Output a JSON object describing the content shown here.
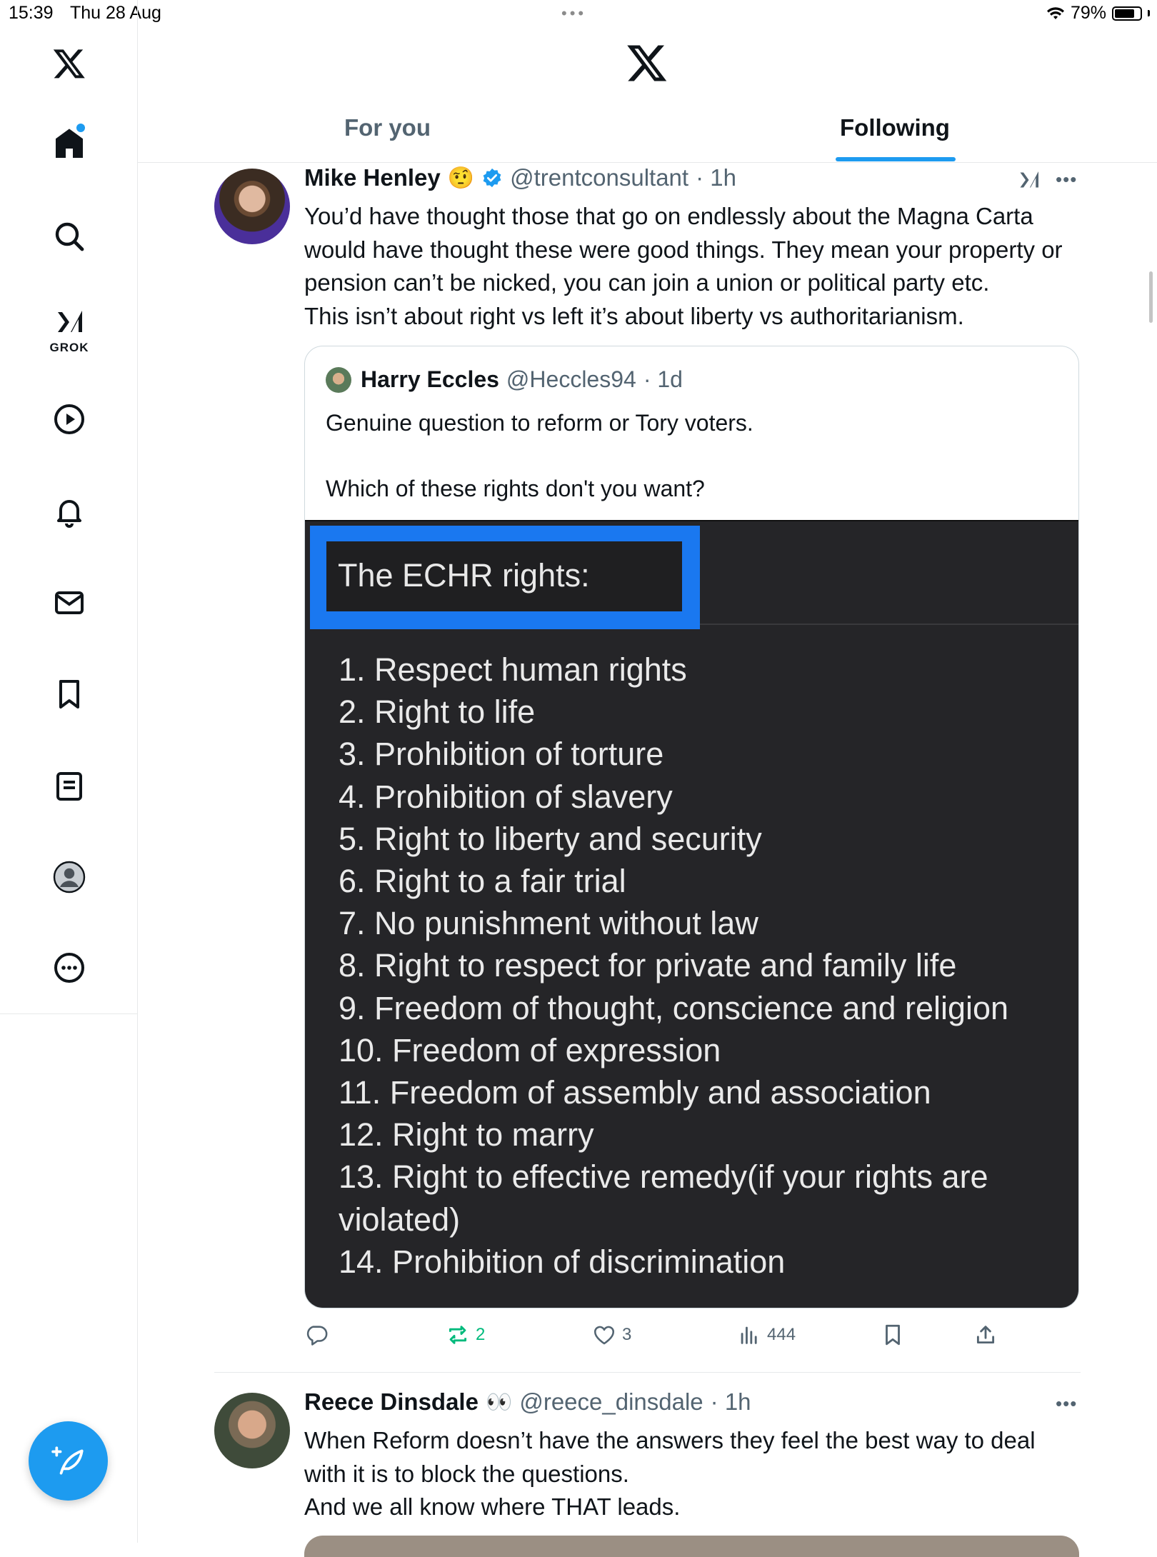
{
  "status_bar": {
    "time": "15:39",
    "date": "Thu 28 Aug",
    "battery": "79%",
    "battery_level": 0.79
  },
  "sidebar": {
    "items": [
      {
        "name": "home",
        "icon": "home-icon"
      },
      {
        "name": "search",
        "icon": "search-icon"
      },
      {
        "name": "grok",
        "icon": "grok-icon",
        "label": "GROK"
      },
      {
        "name": "video",
        "icon": "play-icon"
      },
      {
        "name": "notifications",
        "icon": "bell-icon"
      },
      {
        "name": "messages",
        "icon": "mail-icon"
      },
      {
        "name": "bookmarks",
        "icon": "bookmark-icon"
      },
      {
        "name": "lists",
        "icon": "list-icon"
      },
      {
        "name": "profile",
        "icon": "profile-icon"
      },
      {
        "name": "more",
        "icon": "more-icon"
      }
    ]
  },
  "header": {
    "tabs": [
      {
        "label": "For you",
        "active": false
      },
      {
        "label": "Following",
        "active": true
      }
    ]
  },
  "accent_color": "#1d9bf0",
  "tweets": [
    {
      "name": "Mike Henley",
      "emoji": "🤨",
      "verified": true,
      "handle": "@trentconsultant",
      "time": "· 1h",
      "text": "You’d have thought those that go on endlessly about the Magna Carta would have thought these were good things. They mean your property or pension can’t be nicked, you can join a union or political party etc.\nThis isn’t about right vs left it’s about liberty vs authoritarianism.",
      "quote": {
        "name": "Harry Eccles",
        "handle": "@Heccles94",
        "time": "· 1d",
        "text": "Genuine question to reform or Tory voters.\n\nWhich of these rights don't you want?",
        "image": {
          "title": "The ECHR rights:",
          "items": [
            "1. Respect human rights",
            "2. Right to life",
            "3. Prohibition of torture",
            "4. Prohibition of slavery",
            "5. Right to liberty and security",
            "6. Right to a fair trial",
            "7. No punishment without law",
            "8. Right to respect for private and family life",
            "9. Freedom of thought, conscience and religion",
            "10. Freedom of expression",
            "11. Freedom of assembly and association",
            "12. Right to marry",
            "13. Right to effective remedy(if your rights are violated)",
            "14. Prohibition of discrimination"
          ]
        }
      },
      "actions": {
        "reposts": "2",
        "likes": "3",
        "views": "444"
      }
    },
    {
      "name": "Reece Dinsdale",
      "emoji": "👀",
      "handle": "@reece_dinsdale",
      "time": "· 1h",
      "text": "When Reform doesn’t have the answers they feel the best way to deal with it is to block the questions.\nAnd we all know where THAT leads."
    }
  ]
}
